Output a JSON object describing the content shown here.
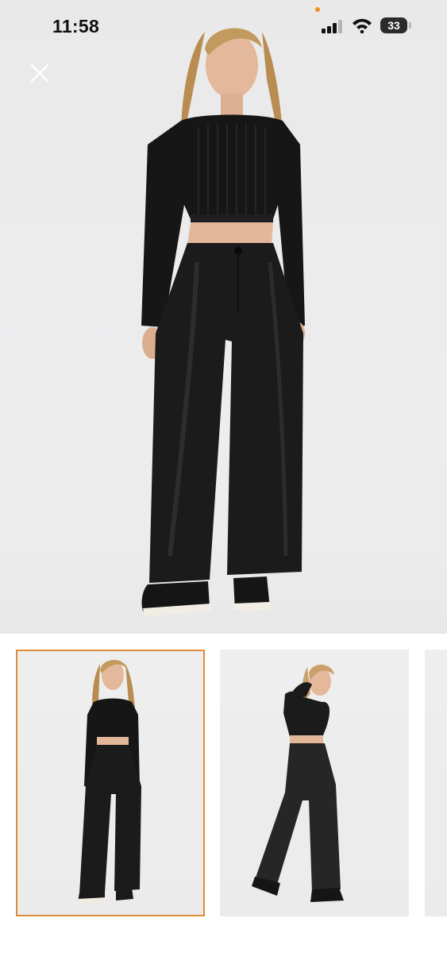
{
  "status_bar": {
    "time": "11:58",
    "battery": "33",
    "icons": [
      "signal-icon",
      "wifi-icon",
      "battery-icon"
    ],
    "indicator_color": "#f0901c"
  },
  "viewer": {
    "close_icon": "close-icon",
    "main_image": "model-front-view",
    "thumbnails": [
      {
        "image": "model-front-view",
        "selected": true
      },
      {
        "image": "model-walking-view",
        "selected": false
      },
      {
        "image": "model-view-3",
        "selected": false
      }
    ],
    "selected_border_color": "#e08a3a"
  }
}
